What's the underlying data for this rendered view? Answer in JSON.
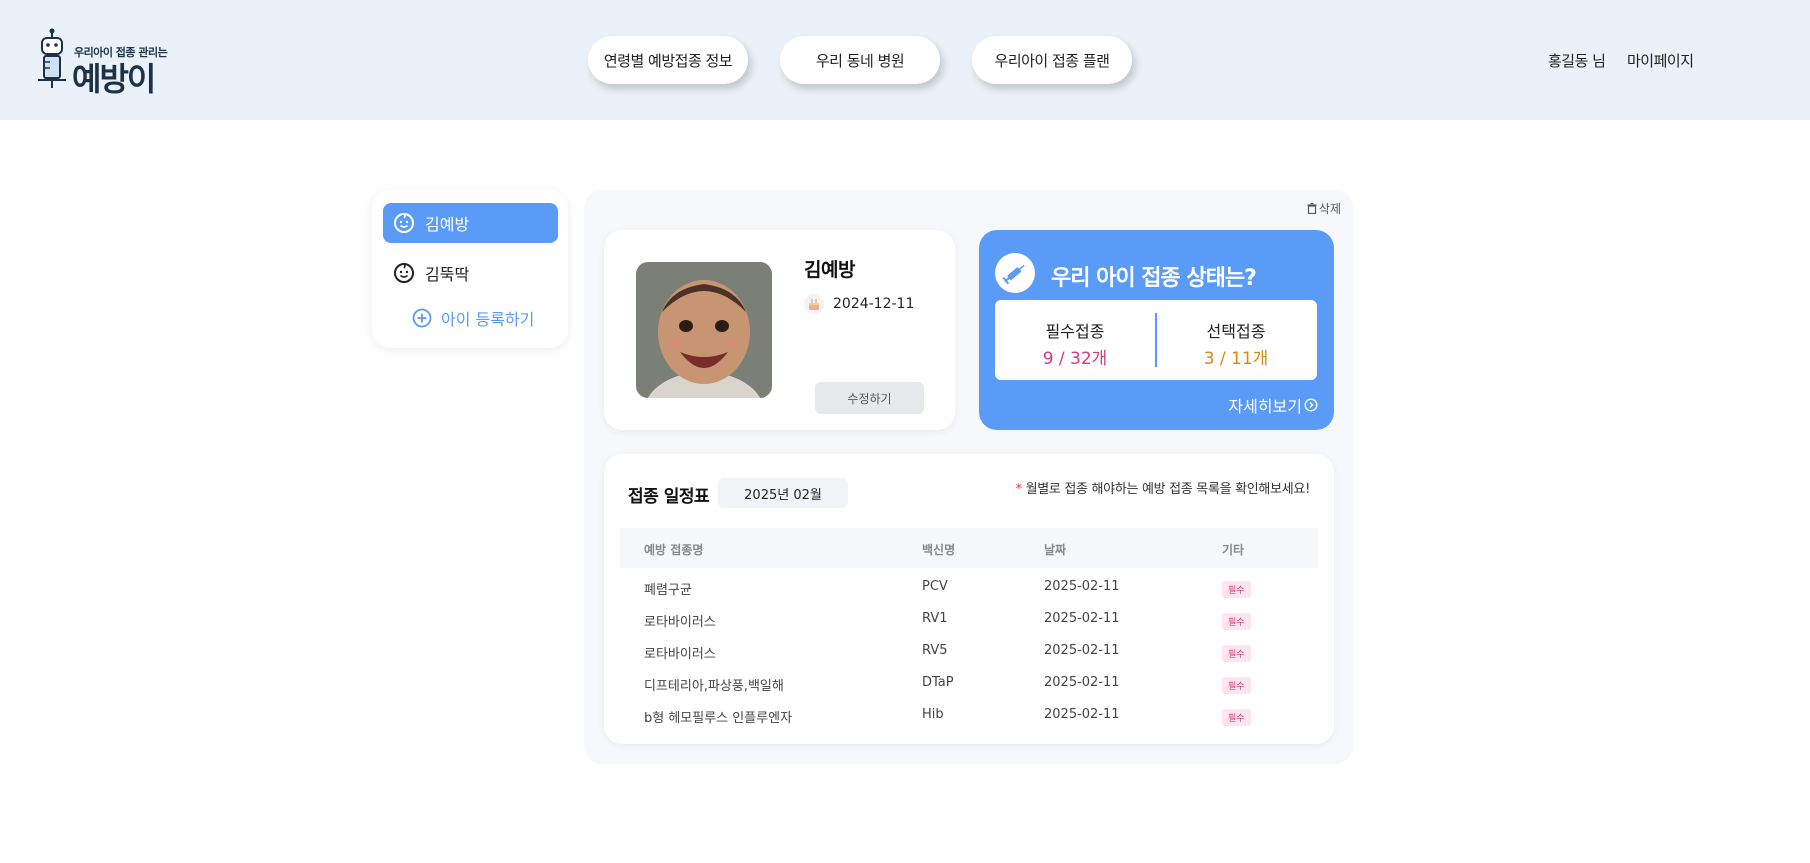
{
  "header": {
    "logo_tagline": "우리아이 접종 관리는",
    "logo_brand": "예방이",
    "nav": [
      "연령별 예방접종 정보",
      "우리 동네 병원",
      "우리아이 접종 플랜"
    ],
    "user_name": "홍길동 님",
    "mypage": "마이페이지"
  },
  "sidebar": {
    "children": [
      "김예방",
      "김뚝딱"
    ],
    "add_label": "아이 등록하기"
  },
  "main": {
    "delete_label": "삭제",
    "profile": {
      "name": "김예방",
      "birthday": "2024-12-11",
      "edit_label": "수정하기"
    },
    "status": {
      "title": "우리 아이 접종 상태는?",
      "required_label": "필수접종",
      "required_value": "9 / 32개",
      "optional_label": "선택접종",
      "optional_value": "3 / 11개",
      "detail_label": "자세히보기"
    },
    "schedule": {
      "title": "접종 일정표",
      "month": "2025년 02월",
      "note_star": "*",
      "note": "월별로 접종 해야하는 예방 접종 목록을 확인해보세요!",
      "headers": [
        "예방 접종명",
        "백신명",
        "날짜",
        "기타"
      ],
      "rows": [
        {
          "name": "폐렴구균",
          "vaccine": "PCV",
          "date": "2025-02-11",
          "tag": "필수"
        },
        {
          "name": "로타바이러스",
          "vaccine": "RV1",
          "date": "2025-02-11",
          "tag": "필수"
        },
        {
          "name": "로타바이러스",
          "vaccine": "RV5",
          "date": "2025-02-11",
          "tag": "필수"
        },
        {
          "name": "디프테리아,파상풍,백일해",
          "vaccine": "DTaP",
          "date": "2025-02-11",
          "tag": "필수"
        },
        {
          "name": "b형 헤모필루스 인플루엔자",
          "vaccine": "Hib",
          "date": "2025-02-11",
          "tag": "필수"
        }
      ]
    }
  },
  "colors": {
    "accent": "#5b9bf8",
    "header_bg": "#eaf1f8",
    "required": "#d63a7a",
    "optional": "#d88a12"
  }
}
